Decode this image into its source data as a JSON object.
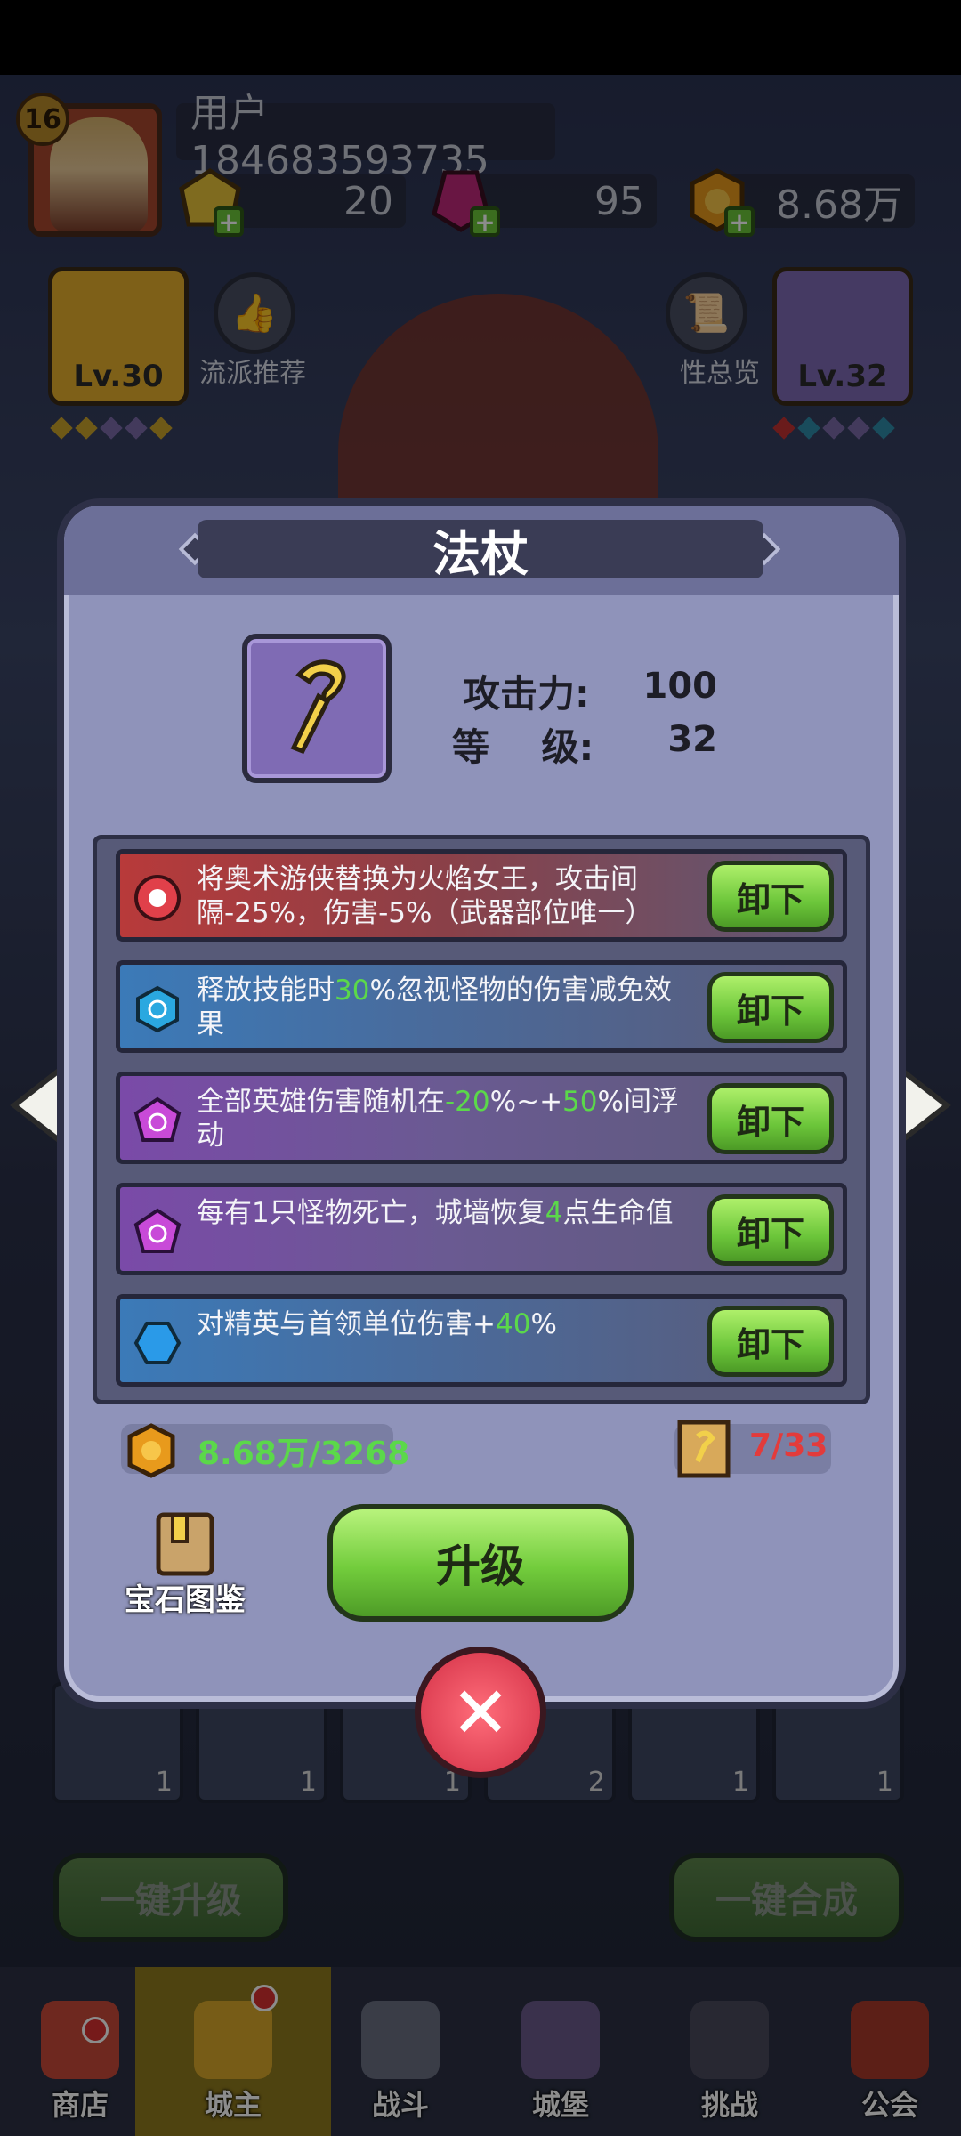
{
  "player": {
    "level": "16",
    "name": "用户184683593735"
  },
  "resources": [
    {
      "name": "diamond-gem",
      "value": "20",
      "color": "#e8c43a"
    },
    {
      "name": "ruby",
      "value": "95",
      "color": "#c0287a"
    },
    {
      "name": "gold",
      "value": "8.68万",
      "color": "#e89a1c"
    }
  ],
  "hero_panel": {
    "left_card_level": "Lv.30",
    "right_card_level": "Lv.32",
    "build_recommend_label": "流派推荐",
    "overview_label": "性总览"
  },
  "dialog": {
    "title": "法杖",
    "stats": [
      {
        "label": "攻击力:",
        "value": "100"
      },
      {
        "label": "等    级:",
        "value": "32"
      }
    ],
    "affixes": [
      {
        "parts": [
          "将奥术游侠替换为火焰女王，攻击间隔-25%，伤害-5%（武器部位唯一）"
        ],
        "gem": "red-sun-gem-icon",
        "bg": "red"
      },
      {
        "parts": [
          "释放技能时",
          "30",
          "%忽视怪物的伤害减免效果"
        ],
        "gem": "blue-swirl-gem-icon",
        "bg": "blue"
      },
      {
        "parts": [
          "全部英雄伤害随机在",
          "-20",
          "%~+",
          "50",
          "%间浮动"
        ],
        "gem": "purple-swirl-gem-icon",
        "bg": "purple"
      },
      {
        "parts": [
          "每有1只怪物死亡，城墙恢复",
          "4",
          "点生命值"
        ],
        "gem": "purple-swirl-gem-icon",
        "bg": "purple"
      },
      {
        "parts": [
          "对精英与首领单位伤害+",
          "40",
          "%"
        ],
        "gem": "blue-gem-icon",
        "bg": "blue"
      }
    ],
    "unequip_label": "卸下",
    "gold_cost": "8.68万/3268",
    "scroll_count": "7/33",
    "gem_book_label": "宝石图鉴",
    "upgrade_label": "升级"
  },
  "inventory_counts": [
    "1",
    "1",
    "1",
    "2",
    "1",
    "1"
  ],
  "bottom_buttons": {
    "left": "一键升级",
    "right": "一键合成"
  },
  "nav": [
    {
      "label": "商店",
      "dot": true
    },
    {
      "label": "城主",
      "dot": true,
      "active": true
    },
    {
      "label": "战斗",
      "dot": false
    },
    {
      "label": "城堡",
      "dot": false
    },
    {
      "label": "挑战",
      "dot": false
    },
    {
      "label": "公会",
      "dot": false
    }
  ]
}
